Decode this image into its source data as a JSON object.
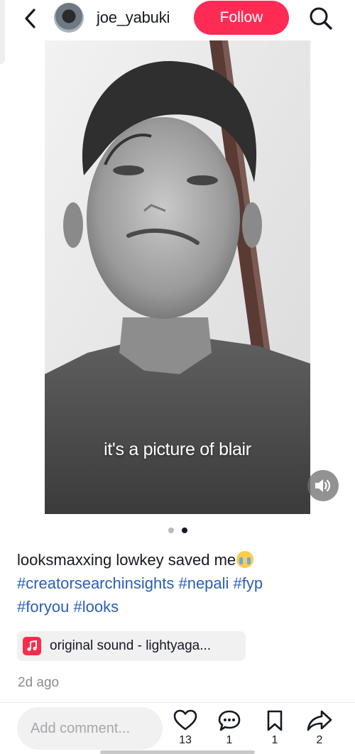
{
  "header": {
    "username": "joe_yabuki",
    "follow_label": "Follow",
    "back_icon": "chevron-left-icon",
    "search_icon": "search-icon"
  },
  "post": {
    "overlay_caption": "it's a picture of blair",
    "slide_total": 2,
    "active_slide": 2,
    "description": "looksmaxxing lowkey saved me",
    "description_emoji": "loudly-crying-face",
    "hashtags": [
      "#creatorsearchinsights",
      "#nepali",
      "#fyp",
      "#foryou",
      "#looks"
    ],
    "sound": "original sound - lightyaga...",
    "posted": "2d ago"
  },
  "actions": {
    "comment_placeholder": "Add comment...",
    "likes": "13",
    "comments": "1",
    "saves": "1",
    "shares": "2"
  },
  "colors": {
    "accent": "#fe2c55",
    "hashtag": "#2b5db9",
    "muted": "#8a8b91",
    "music_icon_bg": "#fa2d48"
  }
}
